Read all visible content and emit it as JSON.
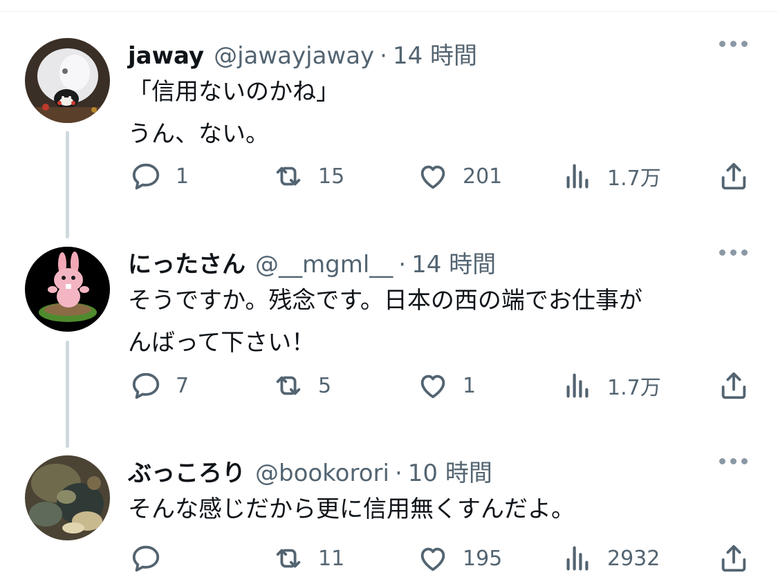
{
  "colors": {
    "text": "#0f1419",
    "secondary": "#536471",
    "thread_line": "#cfd9de",
    "divider": "#eff3f4"
  },
  "icons": {
    "reply": "comment-bubble-icon",
    "retweet": "retweet-arrows-icon",
    "like": "heart-icon",
    "views": "bar-chart-icon",
    "share": "share-upload-icon",
    "more": "three-dots-icon"
  },
  "tweets": [
    {
      "name": "jaway",
      "handle": "@jawayjaway",
      "separator": "·",
      "time": "14 時間",
      "lines": [
        "「信用ないのかね」",
        "うん、ない。"
      ],
      "replies": "1",
      "retweets": "15",
      "likes": "201",
      "views": "1.7万"
    },
    {
      "name": "にったさん",
      "handle": "@__mgml__",
      "separator": "·",
      "time": "14 時間",
      "lines": [
        "そうですか。残念です。日本の西の端でお仕事が",
        "んばって下さい！"
      ],
      "replies": "7",
      "retweets": "5",
      "likes": "1",
      "views": "1.7万"
    },
    {
      "name": "ぶっころり",
      "handle": "@bookorori",
      "separator": "·",
      "time": "10 時間",
      "lines": [
        "そんな感じだから更に信用無くすんだよ。"
      ],
      "replies": "",
      "retweets": "11",
      "likes": "195",
      "views": "2932"
    }
  ]
}
